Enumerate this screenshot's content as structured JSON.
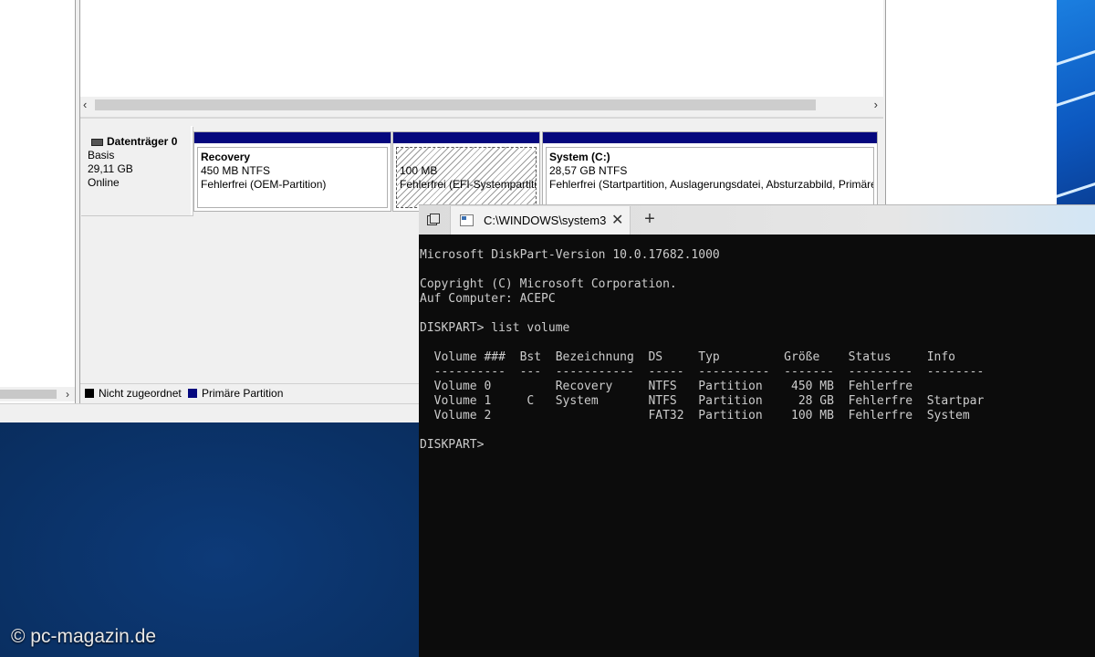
{
  "disk_management": {
    "disk": {
      "name": "Datenträger 0",
      "type": "Basis",
      "size": "29,11 GB",
      "status": "Online"
    },
    "partitions": [
      {
        "title": "Recovery",
        "size": "450 MB NTFS",
        "status": "Fehlerfrei (OEM-Partition)"
      },
      {
        "title": "",
        "size": "100 MB",
        "status": "Fehlerfrei (EFI-Systempartition)"
      },
      {
        "title": "System  (C:)",
        "size": "28,57 GB NTFS",
        "status": "Fehlerfrei (Startpartition, Auslagerungsdatei, Absturzabbild, Primäre Partition)"
      }
    ],
    "legend": {
      "unallocated": "Nicht zugeordnet",
      "primary": "Primäre Partition",
      "unallocated_color": "#000000",
      "primary_color": "#05087e"
    }
  },
  "terminal": {
    "tab_title": "C:\\WINDOWS\\system3",
    "lines": [
      "Microsoft DiskPart-Version 10.0.17682.1000",
      "",
      "Copyright (C) Microsoft Corporation.",
      "Auf Computer: ACEPC",
      "",
      "DISKPART> list volume",
      "",
      "  Volume ###  Bst  Bezeichnung  DS     Typ         Größe    Status     Info",
      "  ----------  ---  -----------  -----  ----------  -------  ---------  --------",
      "  Volume 0         Recovery     NTFS   Partition    450 MB  Fehlerfre",
      "  Volume 1     C   System       NTFS   Partition     28 GB  Fehlerfre  Startpar",
      "  Volume 2                      FAT32  Partition    100 MB  Fehlerfre  System",
      "",
      "DISKPART> "
    ]
  },
  "watermark": "© pc-magazin.de"
}
